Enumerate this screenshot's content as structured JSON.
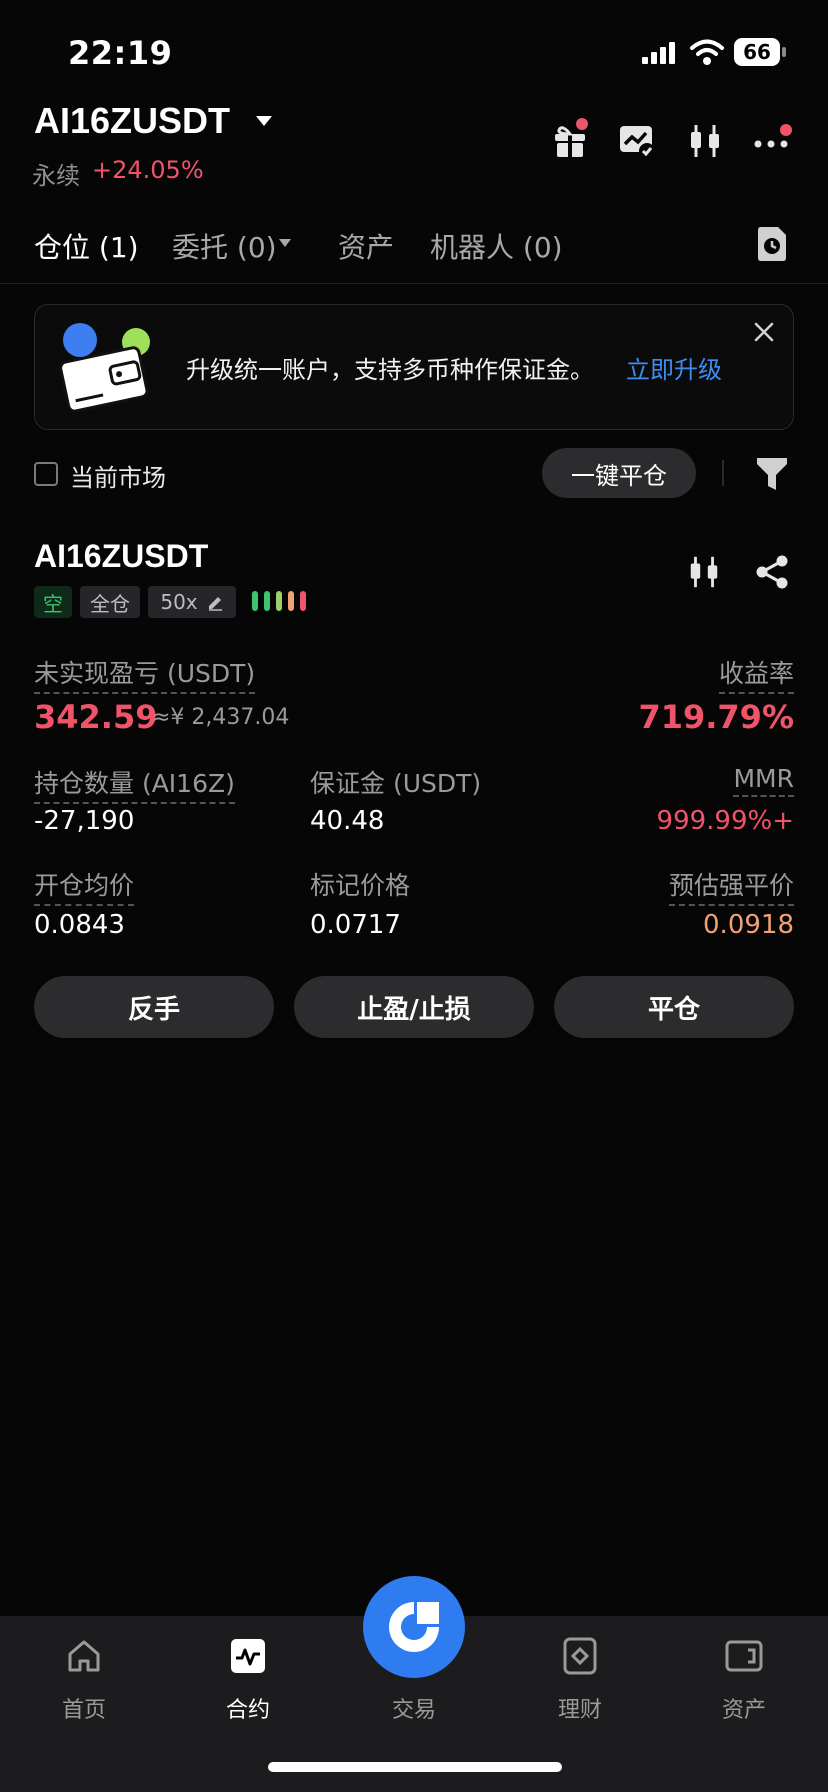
{
  "status_bar": {
    "time": "22:19",
    "battery": "66"
  },
  "header": {
    "pair": "AI16ZUSDT",
    "type": "永续",
    "change": "+24.05%"
  },
  "tabs": [
    {
      "label": "仓位 (1)",
      "active": true
    },
    {
      "label": "委托 (0)",
      "active": false
    },
    {
      "label": "资产",
      "active": false
    },
    {
      "label": "机器人 (0)",
      "active": false
    }
  ],
  "banner": {
    "text": "升级统一账户，支持多币种作保证金。",
    "link": "立即升级"
  },
  "filters": {
    "current_market": "当前市场",
    "close_all": "一键平仓"
  },
  "position": {
    "symbol": "AI16ZUSDT",
    "side": "空",
    "margin_mode": "全仓",
    "leverage": "50x",
    "unrealized_pnl_label": "未实现盈亏 (USDT)",
    "unrealized_pnl": "342.59",
    "unrealized_pnl_cny": "≈¥ 2,437.04",
    "roe_label": "收益率",
    "roe": "719.79%",
    "size_label": "持仓数量 (AI16Z)",
    "size": "-27,190",
    "margin_label": "保证金 (USDT)",
    "margin": "40.48",
    "mmr_label": "MMR",
    "mmr": "999.99%+",
    "entry_label": "开仓均价",
    "entry": "0.0843",
    "mark_label": "标记价格",
    "mark": "0.0717",
    "liq_label": "预估强平价",
    "liq": "0.0918"
  },
  "actions": {
    "reverse": "反手",
    "tpsl": "止盈/止损",
    "close": "平仓"
  },
  "nav": [
    {
      "label": "首页",
      "active": false
    },
    {
      "label": "合约",
      "active": true
    },
    {
      "label": "交易",
      "active": false
    },
    {
      "label": "理财",
      "active": false
    },
    {
      "label": "资产",
      "active": false
    }
  ],
  "colors": {
    "up_red": "#f0546a",
    "accent_blue": "#2f7bf0",
    "short_green": "#3cc46e",
    "liq_orange": "#f2a173"
  }
}
